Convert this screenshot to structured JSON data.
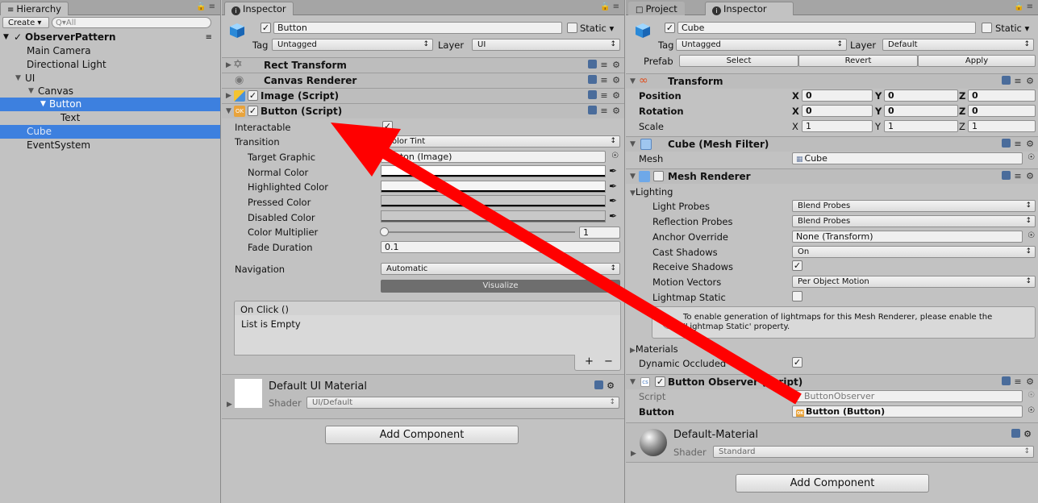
{
  "hierarchy": {
    "tab": "Hierarchy",
    "create": "Create ▾",
    "search_placeholder": "Q▾All",
    "scene": "ObserverPattern",
    "items": [
      "Main Camera",
      "Directional Light",
      "UI",
      "Canvas",
      "Button",
      "Text",
      "Cube",
      "EventSystem"
    ]
  },
  "inspector1": {
    "tab": "Inspector",
    "name": "Button",
    "static_label": "Static ▾",
    "tag_label": "Tag",
    "tag_value": "Untagged",
    "layer_label": "Layer",
    "layer_value": "UI",
    "components": {
      "rect_transform": "Rect Transform",
      "canvas_renderer": "Canvas Renderer",
      "image_script": "Image (Script)",
      "button_script": "Button (Script)"
    },
    "props": {
      "interactable": "Interactable",
      "transition": "Transition",
      "transition_value": "Color Tint",
      "target_graphic": "Target Graphic",
      "target_graphic_value": "Button (Image)",
      "normal_color": "Normal Color",
      "highlighted_color": "Highlighted Color",
      "pressed_color": "Pressed Color",
      "disabled_color": "Disabled Color",
      "color_multiplier": "Color Multiplier",
      "color_multiplier_value": "1",
      "fade_duration": "Fade Duration",
      "fade_duration_value": "0.1",
      "navigation": "Navigation",
      "navigation_value": "Automatic",
      "visualize": "Visualize"
    },
    "onclick": {
      "header": "On Click ()",
      "empty": "List is Empty",
      "plus": "+",
      "minus": "−"
    },
    "material": {
      "name": "Default UI Material",
      "shader_label": "Shader",
      "shader_value": "UI/Default"
    },
    "add_component": "Add Component"
  },
  "inspector2": {
    "tab_project": "Project",
    "tab": "Inspector",
    "name": "Cube",
    "static_label": "Static ▾",
    "tag_label": "Tag",
    "tag_value": "Untagged",
    "layer_label": "Layer",
    "layer_value": "Default",
    "prefab_label": "Prefab",
    "prefab_buttons": [
      "Select",
      "Revert",
      "Apply"
    ],
    "transform": {
      "title": "Transform",
      "position": "Position",
      "rotation": "Rotation",
      "scale": "Scale",
      "x": "X",
      "y": "Y",
      "z": "Z",
      "position_values": [
        "0",
        "0",
        "0"
      ],
      "rotation_values": [
        "0",
        "0",
        "0"
      ],
      "scale_values": [
        "1",
        "1",
        "1"
      ]
    },
    "mesh_filter": {
      "title": "Cube (Mesh Filter)",
      "mesh_label": "Mesh",
      "mesh_value": "Cube"
    },
    "mesh_renderer": {
      "title": "Mesh Renderer",
      "lighting": "Lighting",
      "light_probes": "Light Probes",
      "light_probes_value": "Blend Probes",
      "reflection_probes": "Reflection Probes",
      "reflection_probes_value": "Blend Probes",
      "anchor_override": "Anchor Override",
      "anchor_override_value": "None (Transform)",
      "cast_shadows": "Cast Shadows",
      "cast_shadows_value": "On",
      "receive_shadows": "Receive Shadows",
      "motion_vectors": "Motion Vectors",
      "motion_vectors_value": "Per Object Motion",
      "lightmap_static": "Lightmap Static",
      "info": "To enable generation of lightmaps for this Mesh Renderer, please enable the 'Lightmap Static' property.",
      "materials": "Materials",
      "dynamic_occluded": "Dynamic Occluded"
    },
    "button_observer": {
      "title": "Button Observer (Script)",
      "script_label": "Script",
      "script_value": "ButtonObserver",
      "button_label": "Button",
      "button_value": "Button (Button)"
    },
    "material": {
      "name": "Default-Material",
      "shader_label": "Shader",
      "shader_value": "Standard"
    },
    "add_component": "Add Component"
  },
  "colors": {
    "selection": "#3d80df",
    "arrow": "#ff0000",
    "panel_bg": "#c2c2c2"
  }
}
